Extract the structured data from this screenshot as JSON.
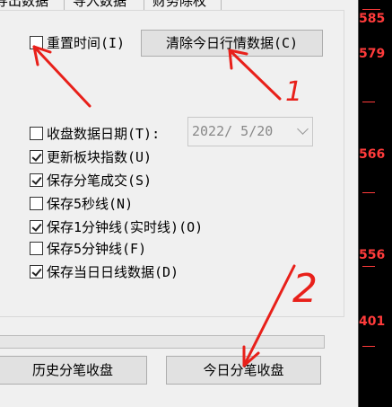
{
  "tabs": [
    "导出数据",
    "导入数据",
    "财务除权"
  ],
  "options": {
    "reset_time": {
      "label": "重置时间(I)",
      "checked": false
    },
    "close_date": {
      "label": "收盘数据日期(T):",
      "checked": false,
      "value": "2022/ 5/20"
    },
    "update_sector_index": {
      "label": "更新板块指数(U)",
      "checked": true
    },
    "save_tick_trades": {
      "label": "保存分笔成交(S)",
      "checked": true
    },
    "save_5sec": {
      "label": "保存5秒线(N)",
      "checked": false
    },
    "save_1min": {
      "label": "保存1分钟线(实时线)(O)",
      "checked": true
    },
    "save_5min": {
      "label": "保存5分钟线(F)",
      "checked": false
    },
    "save_daily": {
      "label": "保存当日日线数据(D)",
      "checked": true
    }
  },
  "buttons": {
    "clear_today": "清除今日行情数据(C)",
    "history_tick_close": "历史分笔收盘",
    "today_tick_close": "今日分笔收盘"
  },
  "right_prices": [
    "585",
    "579",
    "566",
    "556",
    "401"
  ],
  "annotations": {
    "mark1": "1",
    "mark2": "2"
  },
  "colors": {
    "price_red": "#ff3b3b",
    "annotation_red": "#e8201a",
    "panel_bg": "#f0f0f0",
    "chart_bg": "#000000"
  }
}
